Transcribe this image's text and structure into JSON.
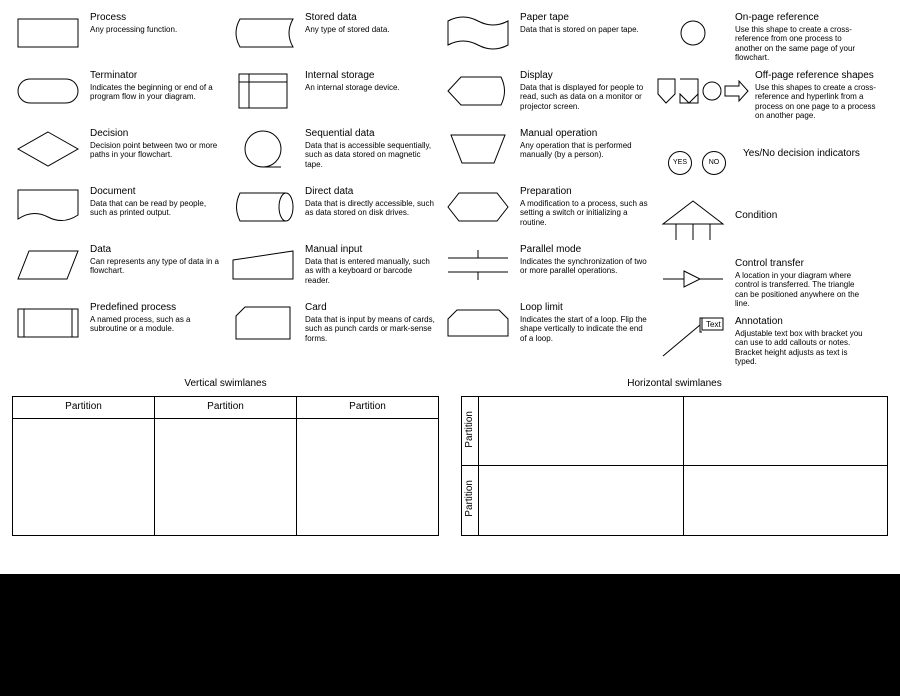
{
  "shapes": {
    "process": {
      "title": "Process",
      "desc": "Any processing function."
    },
    "terminator": {
      "title": "Terminator",
      "desc": "Indicates the beginning or end of a program flow in your diagram."
    },
    "decision": {
      "title": "Decision",
      "desc": "Decision point between two or more paths in your flowchart."
    },
    "document": {
      "title": "Document",
      "desc": "Data that can be read by people, such as printed output."
    },
    "data": {
      "title": "Data",
      "desc": "Can represents any type of data in a flowchart."
    },
    "predefined": {
      "title": "Predefined process",
      "desc": "A named process, such as a subroutine or a module."
    },
    "stored": {
      "title": "Stored data",
      "desc": "Any type of stored data."
    },
    "internal": {
      "title": "Internal storage",
      "desc": "An internal storage device."
    },
    "sequential": {
      "title": "Sequential data",
      "desc": "Data that is accessible sequentially, such as data stored on magnetic tape."
    },
    "direct": {
      "title": "Direct data",
      "desc": "Data that is directly accessible, such as data stored on disk drives."
    },
    "manualin": {
      "title": "Manual input",
      "desc": "Data that is entered manually, such as with a keyboard or barcode reader."
    },
    "card": {
      "title": "Card",
      "desc": "Data that is input by means of cards, such as punch cards or mark-sense forms."
    },
    "paper": {
      "title": "Paper tape",
      "desc": "Data that is stored on paper tape."
    },
    "display": {
      "title": "Display",
      "desc": "Data that is displayed for people to read, such as data on a monitor or projector screen."
    },
    "manualop": {
      "title": "Manual operation",
      "desc": "Any operation that is performed manually (by a person)."
    },
    "prep": {
      "title": "Preparation",
      "desc": "A modification to a process, such as setting a switch or initializing a routine."
    },
    "parallel": {
      "title": "Parallel mode",
      "desc": "Indicates the synchronization of two or more parallel operations."
    },
    "loop": {
      "title": "Loop limit",
      "desc": "Indicates the start of a loop. Flip the shape vertically to indicate the end of a loop."
    },
    "onpage": {
      "title": "On-page reference",
      "desc": "Use this shape to create a cross-reference from one process to another on the same page of your flowchart."
    },
    "offpage": {
      "title": "Off-page reference shapes",
      "desc": "Use this shapes to create a cross-reference and hyperlink from a process on one page to a process on another page."
    },
    "yesno": {
      "title": "Yes/No decision indicators",
      "yes": "YES",
      "no": "NO"
    },
    "condition": {
      "title": "Condition"
    },
    "transfer": {
      "title": "Control transfer",
      "desc": "A location in your diagram where control is transferred. The triangle can be positioned anywhere on the line."
    },
    "annotation": {
      "title": "Annotation",
      "desc": "Adjustable text box with bracket you can use to add callouts or notes. Bracket height adjusts as text is typed.",
      "box": "Text"
    }
  },
  "swimlanes": {
    "vertical": {
      "title": "Vertical swimlanes",
      "partitions": [
        "Partition",
        "Partition",
        "Partition"
      ]
    },
    "horizontal": {
      "title": "Horizontal swimlanes",
      "partitions": [
        "Partition",
        "Partition"
      ]
    }
  }
}
